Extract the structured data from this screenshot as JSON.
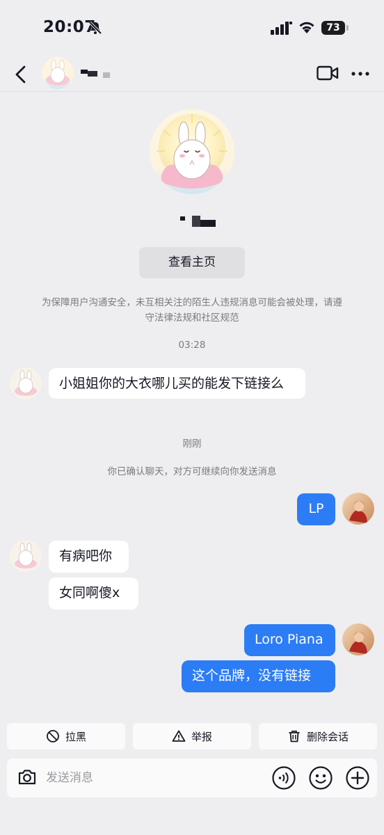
{
  "status_bar": {
    "time": "20:07",
    "battery": "73"
  },
  "header": {
    "title": ""
  },
  "profile": {
    "view_homepage_label": "查看主页"
  },
  "safety_notice": "为保障用户沟通安全，未互相关注的陌生人违规消息可能会被处理，请遵守法律法规和社区规范",
  "chat": {
    "timestamp_1": "03:28",
    "timestamp_2": "刚刚",
    "system_message": "你已确认聊天，对方可继续向你发送消息",
    "messages": [
      {
        "from": "other",
        "text": "小姐姐你的大衣哪儿买的能发下链接么"
      },
      {
        "from": "me",
        "text": "LP"
      },
      {
        "from": "other",
        "text": "有病吧你"
      },
      {
        "from": "other",
        "text": "女同啊傻x"
      },
      {
        "from": "me",
        "text": "Loro Piana"
      },
      {
        "from": "me",
        "text": "这个品牌，没有链接"
      }
    ]
  },
  "actions": {
    "block": "拉黑",
    "report": "举报",
    "delete": "删除会话"
  },
  "composer": {
    "placeholder": "发送消息"
  },
  "colors": {
    "outgoing_bubble": "#2c7cf5",
    "incoming_bubble": "#ffffff",
    "background": "#eeeef0"
  }
}
